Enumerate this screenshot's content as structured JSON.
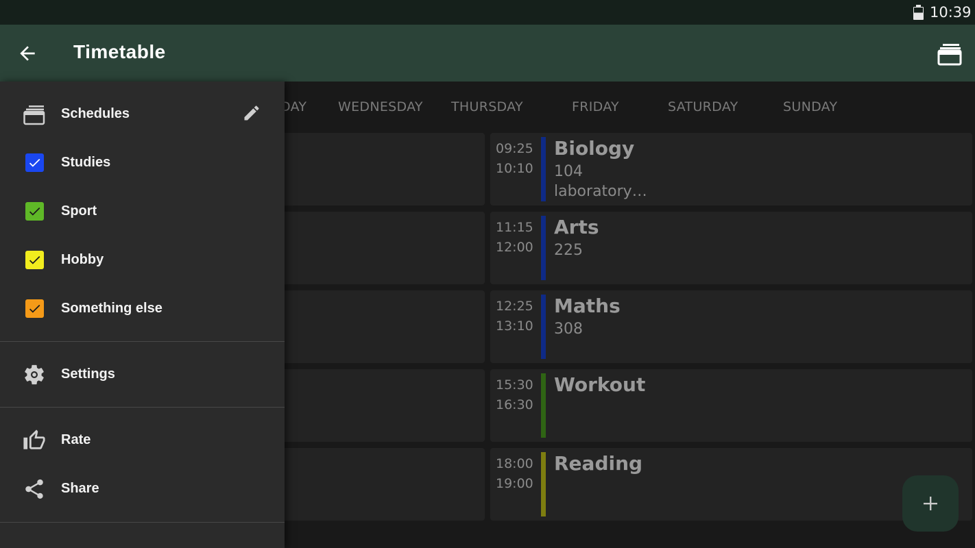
{
  "status_bar": {
    "time": "10:39",
    "battery_icon": "battery-icon"
  },
  "app_bar": {
    "title": "Timetable",
    "back_icon": "arrow-left-icon",
    "action_icon": "schedules-icon"
  },
  "days": [
    "DAY",
    "WEDNESDAY",
    "THURSDAY",
    "FRIDAY",
    "SATURDAY",
    "SUNDAY"
  ],
  "events": [
    {
      "start": "09:25",
      "end": "10:10",
      "name": "Biology",
      "room": "104",
      "note": "laboratory…",
      "color": "#0e2a86"
    },
    {
      "start": "11:15",
      "end": "12:00",
      "name": "Arts",
      "room": "225",
      "note": "",
      "color": "#0e2a86"
    },
    {
      "start": "12:25",
      "end": "13:10",
      "name": "Maths",
      "room": "308",
      "note": "",
      "color": "#0e2a86"
    },
    {
      "start": "15:30",
      "end": "16:30",
      "name": "Workout",
      "room": "",
      "note": "",
      "color": "#2f6414"
    },
    {
      "start": "18:00",
      "end": "19:00",
      "name": "Reading",
      "room": "",
      "note": "",
      "color": "#7d7d10"
    }
  ],
  "drawer": {
    "schedules_label": "Schedules",
    "categories": [
      {
        "label": "Studies",
        "color": "#1a47f0",
        "checked": true
      },
      {
        "label": "Sport",
        "color": "#5fb827",
        "checked": true
      },
      {
        "label": "Hobby",
        "color": "#f2ed1e",
        "checked": true
      },
      {
        "label": "Something else",
        "color": "#f59a18",
        "checked": true
      }
    ],
    "settings_label": "Settings",
    "rate_label": "Rate",
    "share_label": "Share"
  },
  "colors": {
    "app_bar": "#2b4338",
    "status_bar": "#15201b",
    "drawer": "#2b2b2b",
    "fab": "#20352c"
  }
}
